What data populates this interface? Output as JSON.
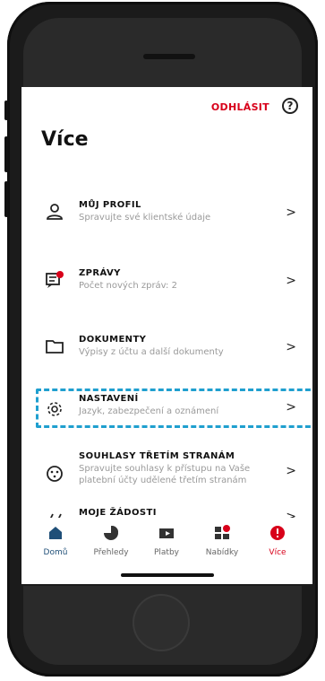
{
  "header": {
    "logout_label": "ODHLÁSIT",
    "help": "?"
  },
  "page": {
    "title": "Více"
  },
  "items": [
    {
      "title": "MŮJ PROFIL",
      "subtitle": "Spravujte své klientské údaje",
      "icon": "user-icon"
    },
    {
      "title": "ZPRÁVY",
      "subtitle": "Počet nových zpráv: 2",
      "icon": "messages-icon"
    },
    {
      "title": "DOKUMENTY",
      "subtitle": "Výpisy z účtu a další dokumenty",
      "icon": "folder-icon"
    },
    {
      "title": "NASTAVENÍ",
      "subtitle": "Jazyk, zabezpečení a oznámení",
      "icon": "gear-icon"
    },
    {
      "title": "SOUHLASY TŘETÍM STRANÁM",
      "subtitle_line1": "Spravujte souhlasy k přístupu na Vaše",
      "subtitle_line2": "platební účty udělené třetím stranám",
      "icon": "consent-icon"
    },
    {
      "title": "MOJE ŽÁDOSTI",
      "icon": "requests-icon"
    }
  ],
  "tabs": [
    {
      "label": "Domů",
      "icon": "home-icon"
    },
    {
      "label": "Přehledy",
      "icon": "overview-icon"
    },
    {
      "label": "Platby",
      "icon": "payments-icon"
    },
    {
      "label": "Nabídky",
      "icon": "offers-icon"
    },
    {
      "label": "Více",
      "icon": "more-icon"
    }
  ],
  "colors": {
    "brand_red": "#d8001a",
    "highlight": "#1f9fcf",
    "active_tab": "#d8001a"
  }
}
